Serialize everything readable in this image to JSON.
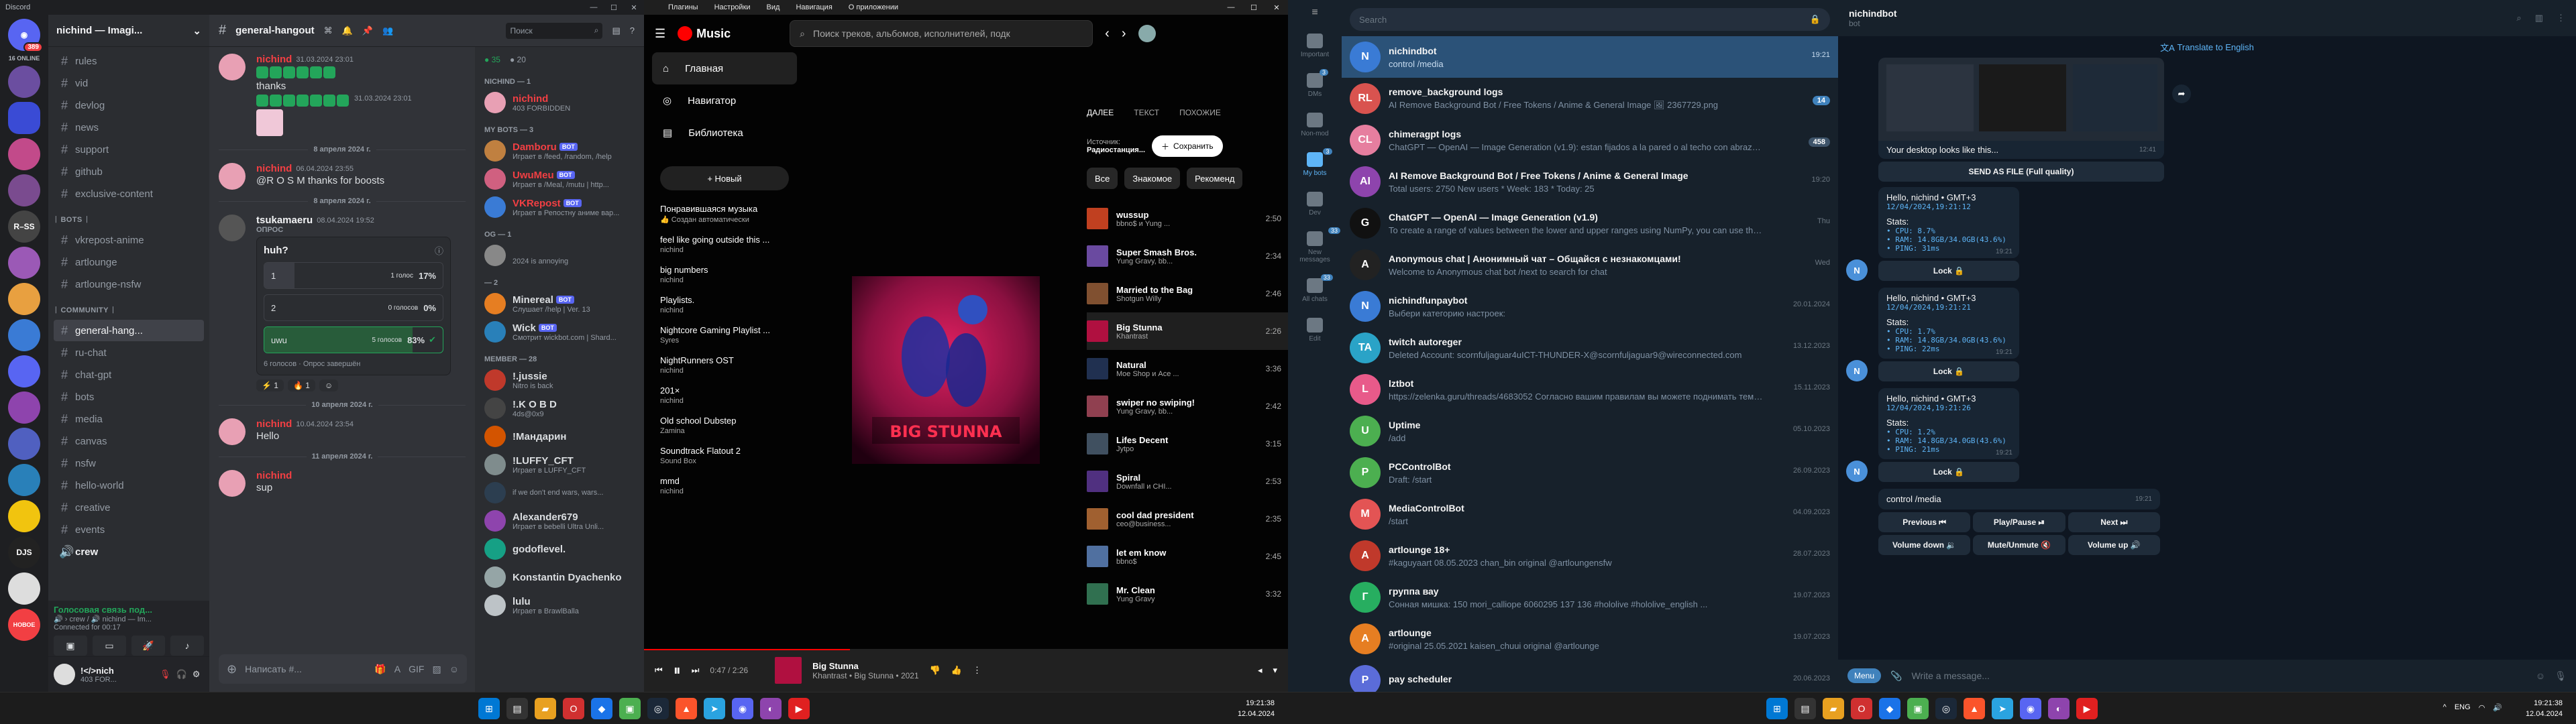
{
  "discord": {
    "app_title": "Discord",
    "server_badge": "389",
    "online_label": "16 ONLINE",
    "guild_name": "nichind — Imagi...",
    "channels_top": [
      "rules",
      "vid",
      "devlog",
      "news",
      "support",
      "github",
      "exclusive-content"
    ],
    "bots_category": "ᛁ BOTS ᛁ",
    "bot_channels": [
      "vkrepost-anime",
      "artlounge",
      "artlounge-nsfw"
    ],
    "community_category": "ᛁ COMMUNITY ᛁ",
    "community_channels": [
      "general-hang...",
      "ru-chat",
      "chat-gpt",
      "bots",
      "media",
      "canvas",
      "nsfw",
      "hello-world",
      "creative",
      "events",
      "crew"
    ],
    "active_channel": "general-hangout",
    "search_placeholder": "Поиск",
    "voice": {
      "title": "Голосовая связь под...",
      "sub": "🔊 › crew / 🔊 nichind — Im...",
      "sub2": "Connected for 00:17"
    },
    "user": {
      "name": "!</>nich",
      "status": "403 FOR..."
    },
    "messages": [
      {
        "name": "nichind",
        "time": "31.03.2024 23:01",
        "text": "thanks",
        "time2": "31.03.2024 23:01"
      },
      {
        "divider": "8 апреля 2024 г."
      },
      {
        "name": "nichind",
        "time": "06.04.2024 23:55",
        "text": "@R O S M thanks for boosts"
      },
      {
        "divider": "8 апреля 2024 г."
      },
      {
        "name": "tsukamaeru",
        "time": "08.04.2024 19:52"
      },
      {
        "divider": "10 апреля 2024 г."
      },
      {
        "name": "nichind",
        "time": "10.04.2024 23:54",
        "text": "Hello"
      },
      {
        "divider": "11 апреля 2024 г."
      },
      {
        "name": "nichind",
        "text": "sup"
      }
    ],
    "poll": {
      "label": "ОПРОС",
      "question": "huh?",
      "options": [
        {
          "label": "1",
          "votes": "1 голос",
          "pct": "17%",
          "value": 17
        },
        {
          "label": "2",
          "votes": "0 голосов",
          "pct": "0%",
          "value": 0
        },
        {
          "label": "uwu",
          "votes": "5 голосов",
          "pct": "83%",
          "value": 83
        }
      ],
      "footer": "6 голосов · Опрос завершён"
    },
    "reactions": [
      "1",
      "1"
    ],
    "input_placeholder": "Написать #...",
    "members": {
      "cat1": "NICHIND — 1",
      "m1": {
        "name": "nichind",
        "status": "403 FORBIDDEN"
      },
      "cat2": "MY BOTS — 3",
      "bots": [
        {
          "name": "Damboru",
          "status": "Играет в /feed, /random, /help"
        },
        {
          "name": "UwuMeu",
          "status": "Играет в /Meal, /mutu | http..."
        },
        {
          "name": "VKRepost",
          "status": "Играет в Репостну аниме вар..."
        }
      ],
      "cat3": "OG — 1",
      "og": {
        "name": "‌",
        "status": "2024 is annoying"
      },
      "cat4": "— 2",
      "m4": [
        {
          "name": "Minereal",
          "status": "Слушает /help | Ver. 13"
        },
        {
          "name": "Wick",
          "status": "Смотрит wickbot.com | Shard..."
        }
      ],
      "cat5": "MEMBER — 28",
      "m5": [
        {
          "name": "!.jussie",
          "status": "Nitro is back"
        },
        {
          "name": "!.K O B D",
          "status": "4ds@‌0x9"
        },
        {
          "name": "!Мандарин",
          "status": ""
        },
        {
          "name": "!LUFFY_CFT",
          "status": "Играет в LUFFY_CFT"
        },
        {
          "name": "",
          "status": "if we don't end wars, wars..."
        },
        {
          "name": "Alexander679",
          "status": "Играет в bebelli Ultra Unli..."
        },
        {
          "name": "godoflevel.",
          "status": ""
        },
        {
          "name": "Konstantin Dyachenko",
          "status": ""
        },
        {
          "name": "lulu",
          "status": "Играет в BrawlBalla"
        }
      ]
    }
  },
  "ytm": {
    "menu": [
      "Плагины",
      "Настройки",
      "Вид",
      "Навигация",
      "О приложении"
    ],
    "logo": "Music",
    "search_placeholder": "Поиск треков, альбомов, исполнителей, подк",
    "nav": [
      "Главная",
      "Навигатор",
      "Библиотека"
    ],
    "new_playlist": "+ Новый",
    "playlists": [
      {
        "t": "Понравившаяся музыка",
        "s": "👍 Создан автоматически"
      },
      {
        "t": "feel like going outside this ...",
        "s": "nichind"
      },
      {
        "t": "big numbers",
        "s": "nichind"
      },
      {
        "t": "Playlists.",
        "s": "nichind"
      },
      {
        "t": "Nightcore Gaming Playlist ...",
        "s": "Syres"
      },
      {
        "t": "NightRunners OST",
        "s": "nichind"
      },
      {
        "t": "201×",
        "s": "nichind"
      },
      {
        "t": "Old school Dubstep",
        "s": "Zamina"
      },
      {
        "t": "Soundtrack Flatout 2",
        "s": "Sound Box"
      },
      {
        "t": "mmd",
        "s": "nichind"
      }
    ],
    "tabs": [
      "ДАЛЕЕ",
      "ТЕКСТ",
      "ПОХОЖИЕ"
    ],
    "source_label": "Источник:",
    "source_value": "Радиостанция...",
    "save": "Сохранить",
    "chips": [
      "Все",
      "Знакомое",
      "Рекоменд"
    ],
    "queue": [
      {
        "t": "wussup",
        "a": "bbno$ и Yung ...",
        "d": "2:50"
      },
      {
        "t": "Super Smash Bros.",
        "a": "Yung Gravy, bb...",
        "d": "2:34"
      },
      {
        "t": "Married to the Bag",
        "a": "Shotgun Willy",
        "d": "2:46"
      },
      {
        "t": "Big Stunna",
        "a": "Khantrast",
        "d": "2:26"
      },
      {
        "t": "Natural",
        "a": "Moe Shop и Ace ...",
        "d": "3:36"
      },
      {
        "t": "swiper no swiping!",
        "a": "Yung Gravy, bb...",
        "d": "2:42"
      },
      {
        "t": "Lifes Decent",
        "a": "Jytpo",
        "d": "3:15"
      },
      {
        "t": "Spiral",
        "a": "Downfall и CHI...",
        "d": "2:53"
      },
      {
        "t": "cool dad president",
        "a": "ceo@business...",
        "d": "2:35"
      },
      {
        "t": "let em know",
        "a": "bbno$",
        "d": "2:45"
      },
      {
        "t": "Mr. Clean",
        "a": "Yung Gravy",
        "d": "3:32"
      }
    ],
    "art_text": "BIG STUNNA",
    "player": {
      "time": "0:47 / 2:26",
      "title": "Big Stunna",
      "sub": "Khantrast • Big Stunna • 2021",
      "progress": 0.32
    }
  },
  "tg": {
    "rail": [
      {
        "label": "Important",
        "count": ""
      },
      {
        "label": "DMs",
        "count": "3"
      },
      {
        "label": "Non-mod",
        "count": ""
      },
      {
        "label": "My bots",
        "count": "3"
      },
      {
        "label": "Dev",
        "count": ""
      },
      {
        "label": "New messages",
        "count": "33"
      },
      {
        "label": "All chats",
        "count": "33"
      },
      {
        "label": "Edit",
        "count": ""
      }
    ],
    "search_placeholder": "Search",
    "dialogs": [
      {
        "name": "nichindbot",
        "prev": "control /media",
        "time": "19:21",
        "badge": "",
        "color": "#3a7bd5",
        "init": "N"
      },
      {
        "name": "remove_background logs",
        "prev": "AI Remove Background Bot / Free Tokens / Anime & General Image 🖼 2367729.png",
        "time": "",
        "badge": "14",
        "color": "#d9534f",
        "init": "RL"
      },
      {
        "name": "chimeragpt logs",
        "prev": "ChatGPT — OpenAI — Image Generation (v1.9): estan fijados a la pared o al techo con abrazade...",
        "time": "",
        "badge": "458",
        "color": "#e67e9f",
        "init": "CL"
      },
      {
        "name": "AI Remove Background Bot / Free Tokens / Anime & General Image",
        "prev": "Total users: 2750 New users * Week: 183 * Today: 25",
        "time": "19:20",
        "badge": "",
        "color": "#8e44ad",
        "init": "AI"
      },
      {
        "name": "ChatGPT — OpenAI — Image Generation (v1.9)",
        "prev": "To create a range of values between the lower and upper ranges using NumPy, you can use the np. linsp...",
        "time": "Thu",
        "badge": "",
        "color": "#111",
        "init": "G"
      },
      {
        "name": "Anonymous chat | Анонимный чат – Общайся с незнакомцами!",
        "prev": "Welcome to Anonymous chat bot /next to search for chat",
        "time": "Wed",
        "badge": "",
        "color": "#222",
        "init": "A"
      },
      {
        "name": "nichindfunpaybot",
        "prev": "Выбери категорию настроек:",
        "time": "20.01.2024",
        "badge": "",
        "color": "#3a7bd5",
        "init": "N"
      },
      {
        "name": "twitch autoreger",
        "prev": "Deleted Account: scornfuljaguar4uICT-THUNDER-X@scornfuljaguar9@wireconnected.com",
        "time": "13.12.2023",
        "badge": "",
        "color": "#2aa3c7",
        "init": "TA"
      },
      {
        "name": "lztbot",
        "prev": "https://zelenka.guru/threads/4683052 Согласно вашим правилам вы можете поднимать тему раз в 36 час...",
        "time": "15.11.2023",
        "badge": "",
        "color": "#e85a8a",
        "init": "L"
      },
      {
        "name": "Uptime",
        "prev": "/add",
        "time": "05.10.2023",
        "badge": "",
        "color": "#4caf50",
        "init": "U"
      },
      {
        "name": "PCControlBot",
        "prev": "Draft: /start",
        "time": "26.09.2023",
        "badge": "",
        "color": "#4caf50",
        "init": "P"
      },
      {
        "name": "MediaControlBot",
        "prev": "/start",
        "time": "04.09.2023",
        "badge": "",
        "color": "#e35454",
        "init": "M"
      },
      {
        "name": "artlounge 18+",
        "prev": "#kaguyaart 08.05.2023 chan_bin original @artloungensfw",
        "time": "28.07.2023",
        "badge": "",
        "color": "#c0392b",
        "init": "A"
      },
      {
        "name": "группа вау",
        "prev": "Сонная мишка: 150 mori_calliope 6060295 137 136 #hololive #hololive_english ...",
        "time": "19.07.2023",
        "badge": "",
        "color": "#27ae60",
        "init": "Г"
      },
      {
        "name": "artlounge",
        "prev": "#original 25.05.2021 kaisen_chuui original @artlounge",
        "time": "19.07.2023",
        "badge": "",
        "color": "#e67e22",
        "init": "A"
      },
      {
        "name": "pay scheduler",
        "prev": "",
        "time": "20.06.2023",
        "badge": "",
        "color": "#5b6cd9",
        "init": "P"
      }
    ],
    "chat_name": "nichindbot",
    "chat_status": "bot",
    "translate": "Translate to English",
    "desktop_caption": "Your desktop looks like this...",
    "desktop_time": "12:41",
    "send_as_file": "SEND AS FILE (Full quality)",
    "stat_msgs": [
      {
        "hello": "Hello, nichind • GMT+3",
        "date": "12/04/2024,19:21:12",
        "cpu": "8.7%",
        "ram": "14.8GB/34.0GB(43.6%)",
        "ping": "31ms",
        "time": "19:21"
      },
      {
        "hello": "Hello, nichind • GMT+3",
        "date": "12/04/2024,19:21:21",
        "cpu": "1.7%",
        "ram": "14.8GB/34.0GB(43.6%)",
        "ping": "22ms",
        "time": "19:21"
      },
      {
        "hello": "Hello, nichind • GMT+3",
        "date": "12/04/2024,19:21:26",
        "cpu": "1.2%",
        "ram": "14.8GB/34.0GB(43.6%)",
        "ping": "21ms",
        "time": "19:21"
      }
    ],
    "stats_label": "Stats:",
    "lock": "Lock 🔒",
    "control_msg": "control /media",
    "control_time": "19:21",
    "media_btns": [
      "Previous ⏮",
      "Play/Pause ⏯",
      "Next ⏭",
      "Volume down 🔉",
      "Mute/Unmute 🔇",
      "Volume up 🔊"
    ],
    "menu_btn": "Menu",
    "input_placeholder": "Write a message..."
  },
  "taskbar": {
    "left_time": "19:21:38",
    "left_date": "12.04.2024",
    "right_time": "19:21:38",
    "right_date": "12.04.2024",
    "lang": "ENG"
  }
}
